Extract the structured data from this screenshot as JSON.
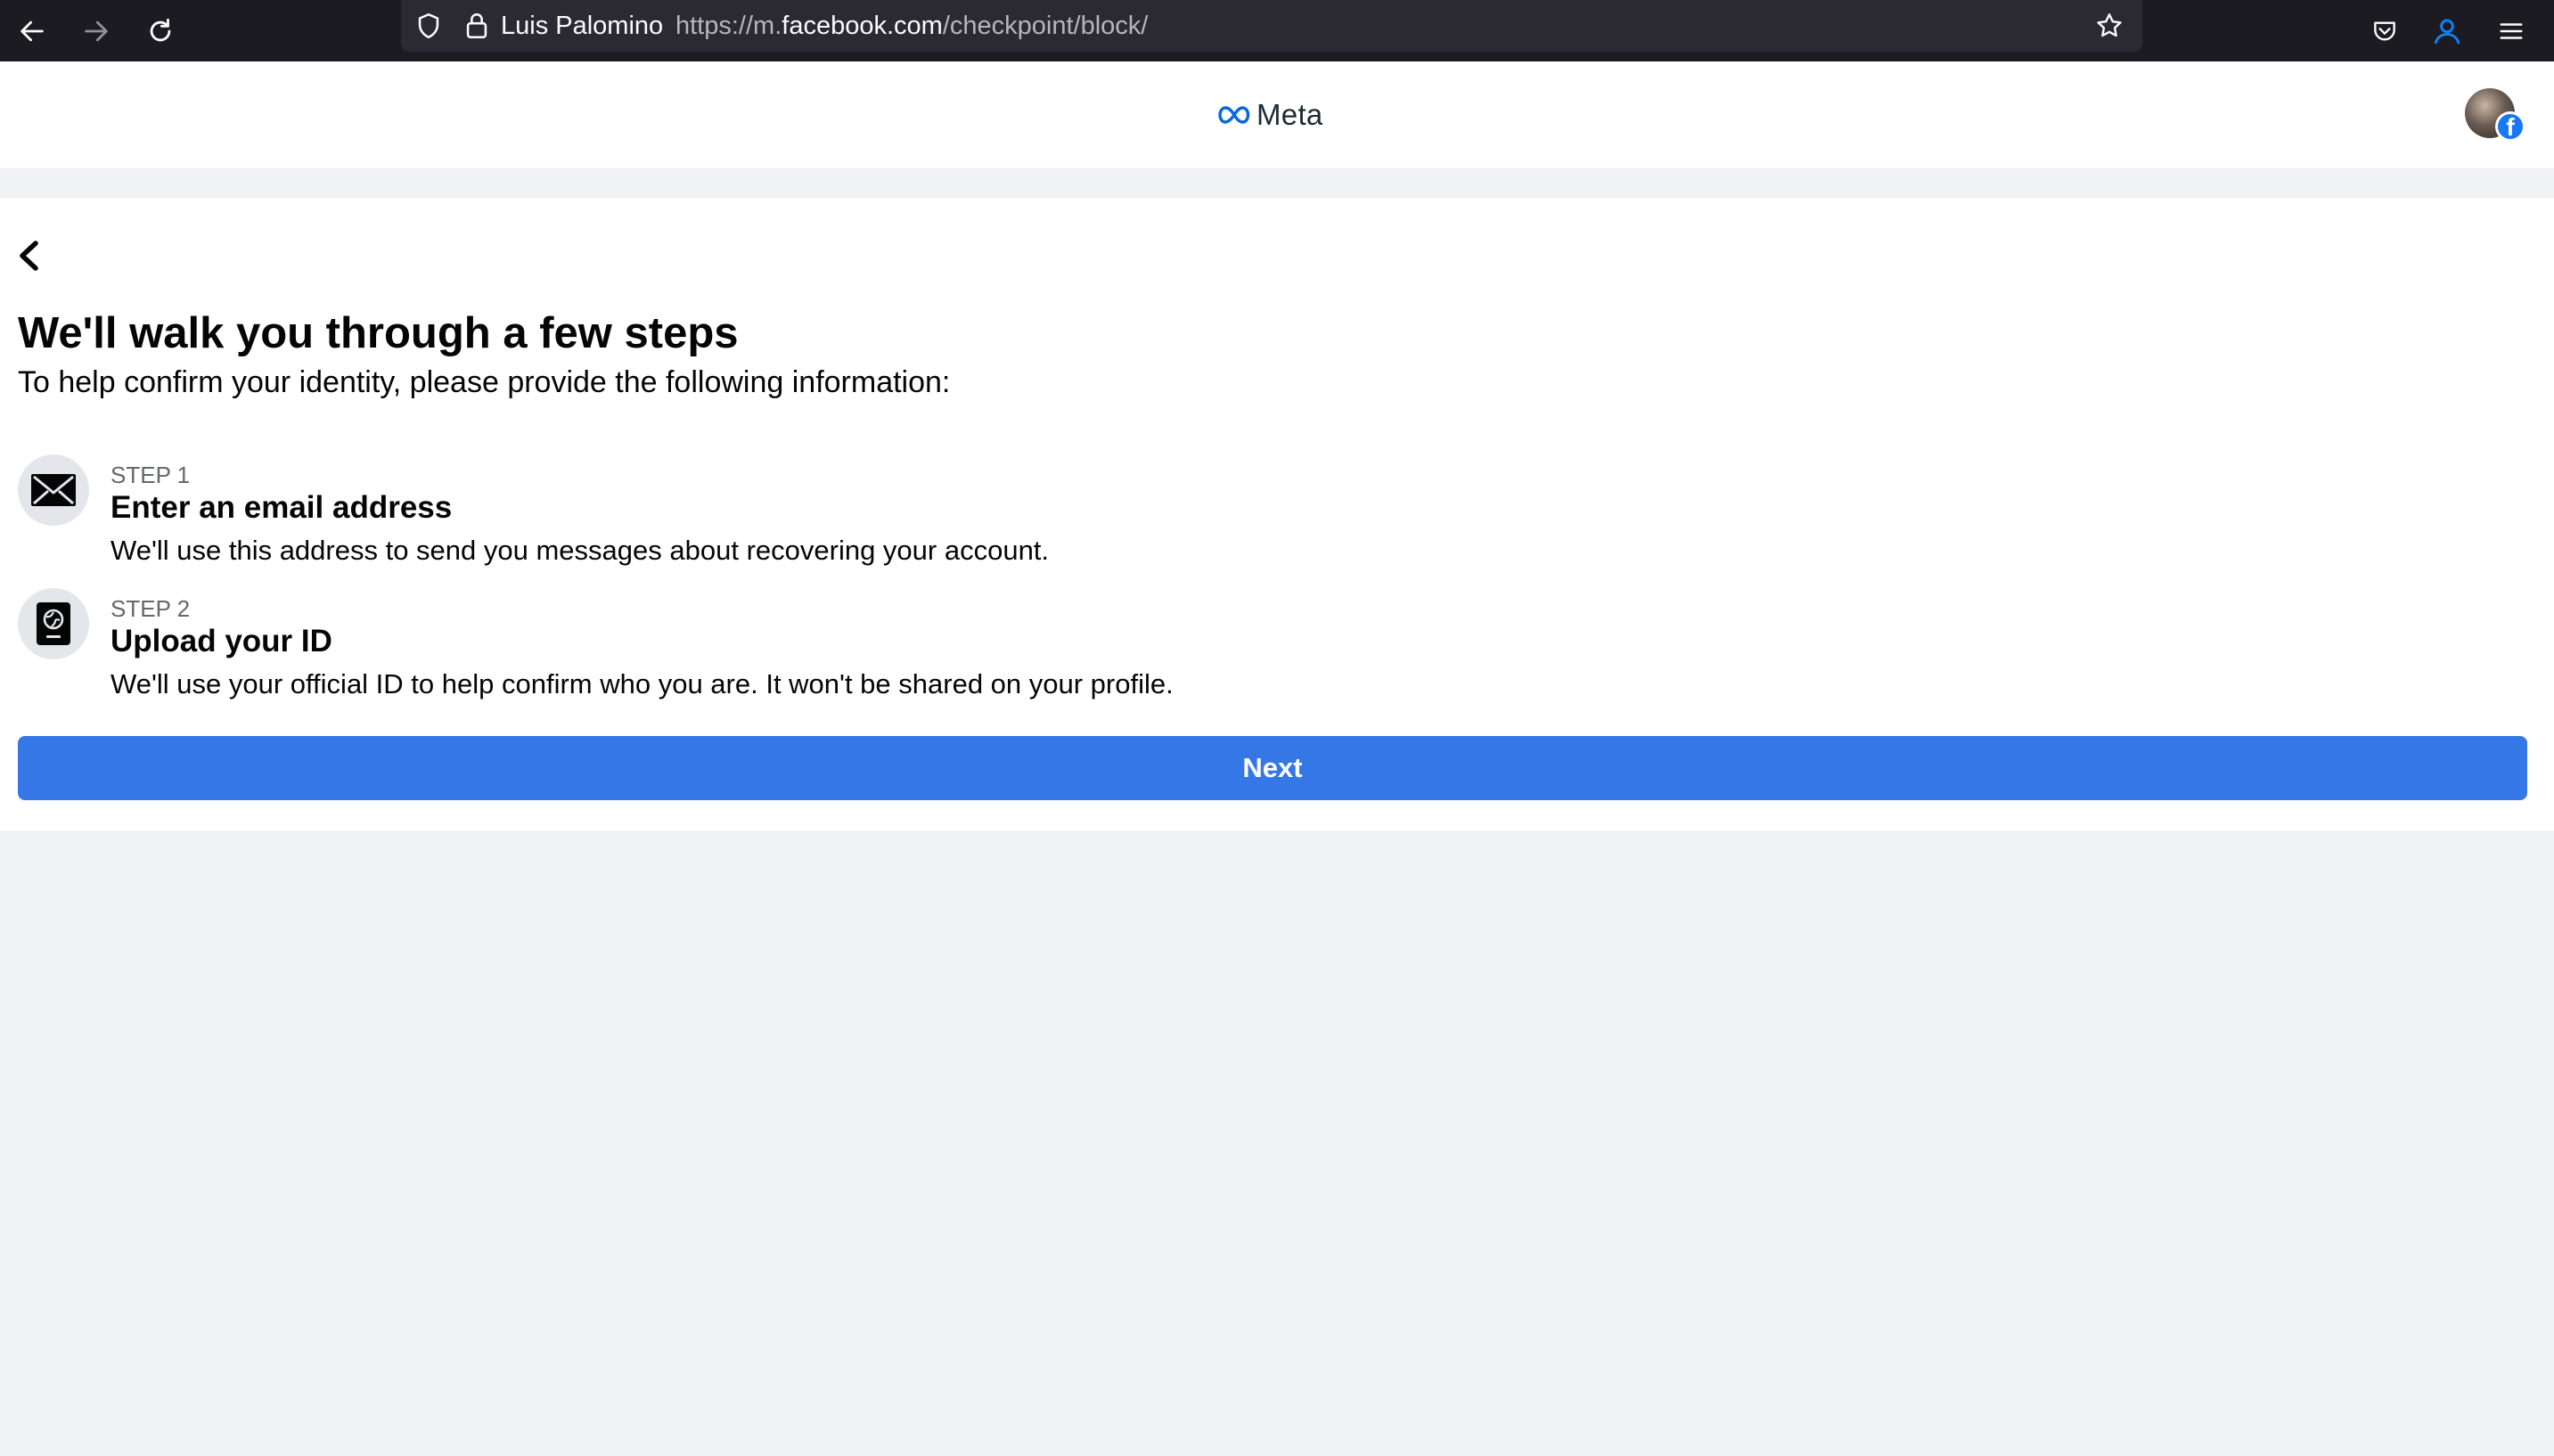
{
  "browser": {
    "identity_label": "Luis Palomino",
    "url_prefix": "https://m.",
    "url_host": "facebook.com",
    "url_path": "/checkpoint/block/",
    "icons": [
      "back-arrow-icon",
      "forward-arrow-icon",
      "reload-icon",
      "shield-icon",
      "lock-icon",
      "bookmark-star-icon",
      "pocket-icon",
      "account-icon",
      "menu-icon"
    ]
  },
  "header": {
    "logo_text": "Meta",
    "logo_color": "#0668e1",
    "fb_badge": "f"
  },
  "main": {
    "title": "We'll walk you through a few steps",
    "subtitle": "To help confirm your identity, please provide the following information:",
    "steps": [
      {
        "label": "STEP 1",
        "title": "Enter an email address",
        "description": "We'll use this address to send you messages about recovering your account.",
        "icon": "envelope-icon"
      },
      {
        "label": "STEP 2",
        "title": "Upload your ID",
        "description": "We'll use your official ID to help confirm who you are. It won't be shared on your profile.",
        "icon": "id-card-icon"
      }
    ],
    "next_label": "Next"
  },
  "colors": {
    "accent": "#3578e5",
    "page_background": "#f0f2f5",
    "toolbar": "#1c1b22",
    "account_icon": "#0a84ff"
  }
}
